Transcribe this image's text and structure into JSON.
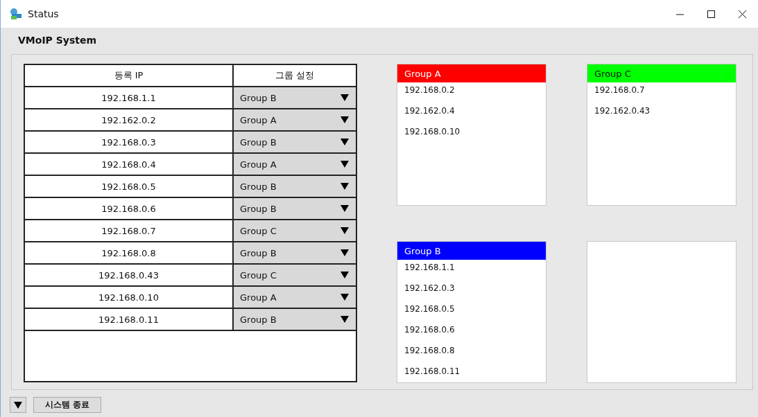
{
  "window": {
    "title": "Status"
  },
  "header": "VMoIP System",
  "table": {
    "columns": [
      "등록 IP",
      "그룹 설정"
    ],
    "rows": [
      {
        "ip": "192.168.1.1",
        "group": "Group B"
      },
      {
        "ip": "192.162.0.2",
        "group": "Group A"
      },
      {
        "ip": "192.168.0.3",
        "group": "Group B"
      },
      {
        "ip": "192.168.0.4",
        "group": "Group A"
      },
      {
        "ip": "192.168.0.5",
        "group": "Group B"
      },
      {
        "ip": "192.168.0.6",
        "group": "Group B"
      },
      {
        "ip": "192.168.0.7",
        "group": "Group C"
      },
      {
        "ip": "192.168.0.8",
        "group": "Group B"
      },
      {
        "ip": "192.168.0.43",
        "group": "Group C"
      },
      {
        "ip": "192.168.0.10",
        "group": "Group A"
      },
      {
        "ip": "192.168.0.11",
        "group": "Group B"
      }
    ]
  },
  "groups": [
    {
      "kind": "group",
      "title": "Group A",
      "color": "#ff0000",
      "items": [
        "192.168.0.2",
        "192.162.0.4",
        "192.168.0.10"
      ]
    },
    {
      "kind": "group",
      "title": "Group C",
      "color": "#00ff00",
      "items": [
        "192.168.0.7",
        "192.162.0.43"
      ]
    },
    {
      "kind": "group",
      "title": "Group B",
      "color": "#0000ff",
      "items": [
        "192.168.1.1",
        "192.162.0.3",
        "192.168.0.5",
        "192.168.0.6",
        "192.168.0.8",
        "192.168.0.11"
      ]
    },
    {
      "kind": "empty"
    }
  ],
  "footer": {
    "button": "시스템 종료"
  }
}
